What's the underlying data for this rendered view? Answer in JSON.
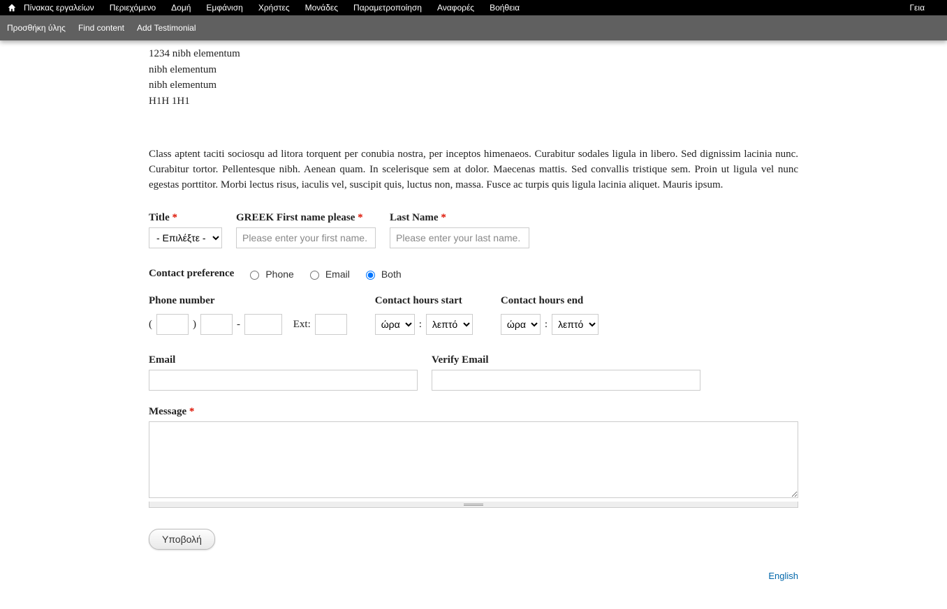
{
  "topbar": {
    "items": [
      "Πίνακας εργαλείων",
      "Περιεχόμενο",
      "Δομή",
      "Εμφάνιση",
      "Χρήστες",
      "Μονάδες",
      "Παραμετροποίηση",
      "Αναφορές",
      "Βοήθεια"
    ],
    "right": "Γεια"
  },
  "subbar": {
    "items": [
      "Προσθήκη ύλης",
      "Find content",
      "Add Testimonial"
    ]
  },
  "prelines": [
    "1234 nibh elementum",
    "nibh elementum",
    "nibh elementum",
    "H1H 1H1"
  ],
  "intro": " Class aptent taciti sociosqu ad litora torquent per conubia nostra, per inceptos himenaeos. Curabitur sodales ligula in libero. Sed dignissim lacinia nunc. Curabitur tortor. Pellentesque nibh. Aenean quam. In scelerisque sem at dolor. Maecenas mattis. Sed convallis tristique sem. Proin ut ligula vel nunc egestas porttitor. Morbi lectus risus, iaculis vel, suscipit quis, luctus non, massa. Fusce ac turpis quis ligula lacinia aliquet. Mauris ipsum.",
  "form": {
    "title_label": "Title",
    "title_option": "- Επιλέξτε -",
    "firstname_label": "GREEK First name please",
    "firstname_placeholder": "Please enter your first name.",
    "lastname_label": "Last Name",
    "lastname_placeholder": "Please enter your last name.",
    "contact_pref_label": "Contact preference",
    "radio": {
      "phone": "Phone",
      "email": "Email",
      "both": "Both"
    },
    "phone_label": "Phone number",
    "ext_label": "Ext:",
    "paren_open": "(",
    "paren_close": ")",
    "dash": "-",
    "colon": ":",
    "hours_start_label": "Contact hours start",
    "hours_end_label": "Contact hours end",
    "hour_option": "ώρα",
    "minute_option": "λεπτό",
    "email_label": "Email",
    "verify_email_label": "Verify Email",
    "message_label": "Message",
    "submit": "Υποβολή"
  },
  "lang": "English",
  "required_marker": "*"
}
